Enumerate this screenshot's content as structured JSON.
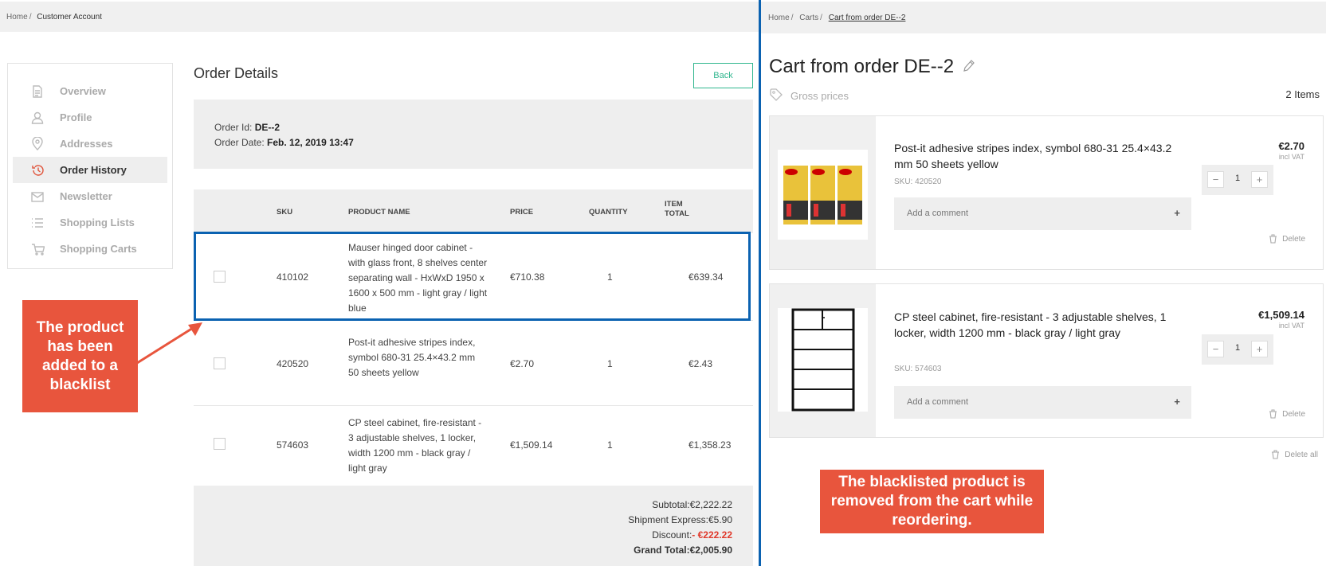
{
  "left": {
    "breadcrumb": {
      "home": "Home",
      "current": "Customer Account"
    },
    "sidebar": {
      "items": [
        {
          "label": "Overview",
          "icon": "document-icon",
          "active": false
        },
        {
          "label": "Profile",
          "icon": "user-icon",
          "active": false
        },
        {
          "label": "Addresses",
          "icon": "location-pin-icon",
          "active": false
        },
        {
          "label": "Order History",
          "icon": "history-icon",
          "active": true
        },
        {
          "label": "Newsletter",
          "icon": "envelope-icon",
          "active": false
        },
        {
          "label": "Shopping Lists",
          "icon": "list-icon",
          "active": false
        },
        {
          "label": "Shopping Carts",
          "icon": "cart-icon",
          "active": false
        }
      ]
    },
    "order": {
      "title": "Order Details",
      "back_label": "Back",
      "id_label": "Order Id:",
      "id_value": "DE--2",
      "date_label": "Order Date:",
      "date_value": "Feb. 12, 2019 13:47"
    },
    "table": {
      "headers": {
        "sku": "SKU",
        "name": "PRODUCT NAME",
        "price": "PRICE",
        "qty": "QUANTITY",
        "total_1": "ITEM",
        "total_2": "TOTAL"
      },
      "rows": [
        {
          "sku": "410102",
          "name": "Mauser hinged door cabinet - with glass front, 8 shelves center separating wall - HxWxD 1950 x 1600 x 500 mm - light gray / light blue",
          "price": "€710.38",
          "qty": "1",
          "total": "€639.34"
        },
        {
          "sku": "420520",
          "name": "Post-it adhesive stripes index, symbol 680-31 25.4×43.2 mm 50 sheets yellow",
          "price": "€2.70",
          "qty": "1",
          "total": "€2.43"
        },
        {
          "sku": "574603",
          "name": "CP steel cabinet, fire-resistant - 3 adjustable shelves, 1 locker, width 1200 mm - black gray / light gray",
          "price": "€1,509.14",
          "qty": "1",
          "total": "€1,358.23"
        }
      ]
    },
    "totals": {
      "subtotal_label": "Subtotal:",
      "subtotal": "€2,222.22",
      "shipment_label": "Shipment Express:",
      "shipment": "€5.90",
      "discount_label": "Discount:",
      "discount": "- €222.22",
      "grand_label": "Grand Total:",
      "grand": "€2,005.90"
    },
    "callout": "The product has been added to a blacklist"
  },
  "right": {
    "breadcrumb": {
      "home": "Home",
      "carts": "Carts",
      "current": "Cart from order DE--2"
    },
    "title": "Cart from order DE--2",
    "gross_prices": "Gross prices",
    "items_count": "2 Items",
    "items": [
      {
        "name": "Post-it adhesive stripes index, symbol 680-31 25.4×43.2 mm 50 sheets yellow",
        "sku": "SKU: 420520",
        "price": "€2.70",
        "vat": "incl VAT",
        "qty": "1",
        "comment_placeholder": "Add a comment",
        "delete_label": "Delete"
      },
      {
        "name": "CP steel cabinet, fire-resistant - 3 adjustable shelves, 1 locker, width 1200 mm - black gray / light gray",
        "sku": "SKU: 574603",
        "price": "€1,509.14",
        "vat": "incl VAT",
        "qty": "1",
        "comment_placeholder": "Add a comment",
        "delete_label": "Delete"
      }
    ],
    "delete_all": "Delete all",
    "callout": "The blacklisted product is removed from the cart while reordering."
  },
  "colors": {
    "accent_red": "#e8553d",
    "highlight_blue": "#0b62b1",
    "back_green": "#2fb68e"
  }
}
